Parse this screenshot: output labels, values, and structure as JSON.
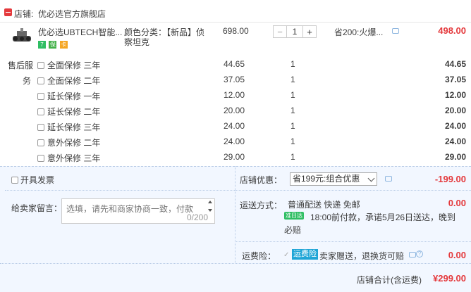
{
  "shop": {
    "label": "店铺:",
    "name": "优必选官方旗舰店"
  },
  "product": {
    "title": "优必选UBTECH智能...",
    "badges": [
      "7",
      "保",
      "卡"
    ],
    "spec_line1": "颜色分类：【新品】侦",
    "spec_line2": "察坦克",
    "unit_price": "698.00",
    "quantity": "1",
    "promo": "省200:火爆...",
    "subtotal": "498.00"
  },
  "services": {
    "label_line1": "售后服",
    "label_line2": "务",
    "items": [
      {
        "name": "全面保修 三年",
        "price": "44.65",
        "qty": "1",
        "subtotal": "44.65"
      },
      {
        "name": "全面保修 二年",
        "price": "37.05",
        "qty": "1",
        "subtotal": "37.05"
      },
      {
        "name": "延长保修 一年",
        "price": "12.00",
        "qty": "1",
        "subtotal": "12.00"
      },
      {
        "name": "延长保修 二年",
        "price": "20.00",
        "qty": "1",
        "subtotal": "20.00"
      },
      {
        "name": "延长保修 三年",
        "price": "24.00",
        "qty": "1",
        "subtotal": "24.00"
      },
      {
        "name": "意外保修 二年",
        "price": "24.00",
        "qty": "1",
        "subtotal": "24.00"
      },
      {
        "name": "意外保修 三年",
        "price": "29.00",
        "qty": "1",
        "subtotal": "29.00"
      }
    ]
  },
  "invoice": {
    "label": "开具发票"
  },
  "shop_discount": {
    "label": "店铺优惠：",
    "selected": "省199元:组合优惠",
    "amount": "-199.00"
  },
  "message": {
    "label": "给卖家留言：",
    "placeholder": "选填，请先和商家协商一致，付款",
    "counter": "0/200"
  },
  "shipping": {
    "label": "运送方式：",
    "method": "普通配送 快递 免邮",
    "tag": "准日达",
    "promise_line1": "18:00前付款，承诺5月26日送达，晚到",
    "promise_line2": "必赔",
    "amount": "0.00"
  },
  "insurance": {
    "label": "运费险：",
    "tag": "运费险",
    "desc": "卖家赠送，退换货可赔",
    "amount": "0.00"
  },
  "total": {
    "label": "店铺合计(含运费)",
    "amount": "¥299.00"
  },
  "colors": {
    "accent_red": "#e4393c",
    "panel_bg": "#f2f7ff",
    "tag_green": "#2fbe63",
    "tag_blue": "#1fa5d6"
  }
}
